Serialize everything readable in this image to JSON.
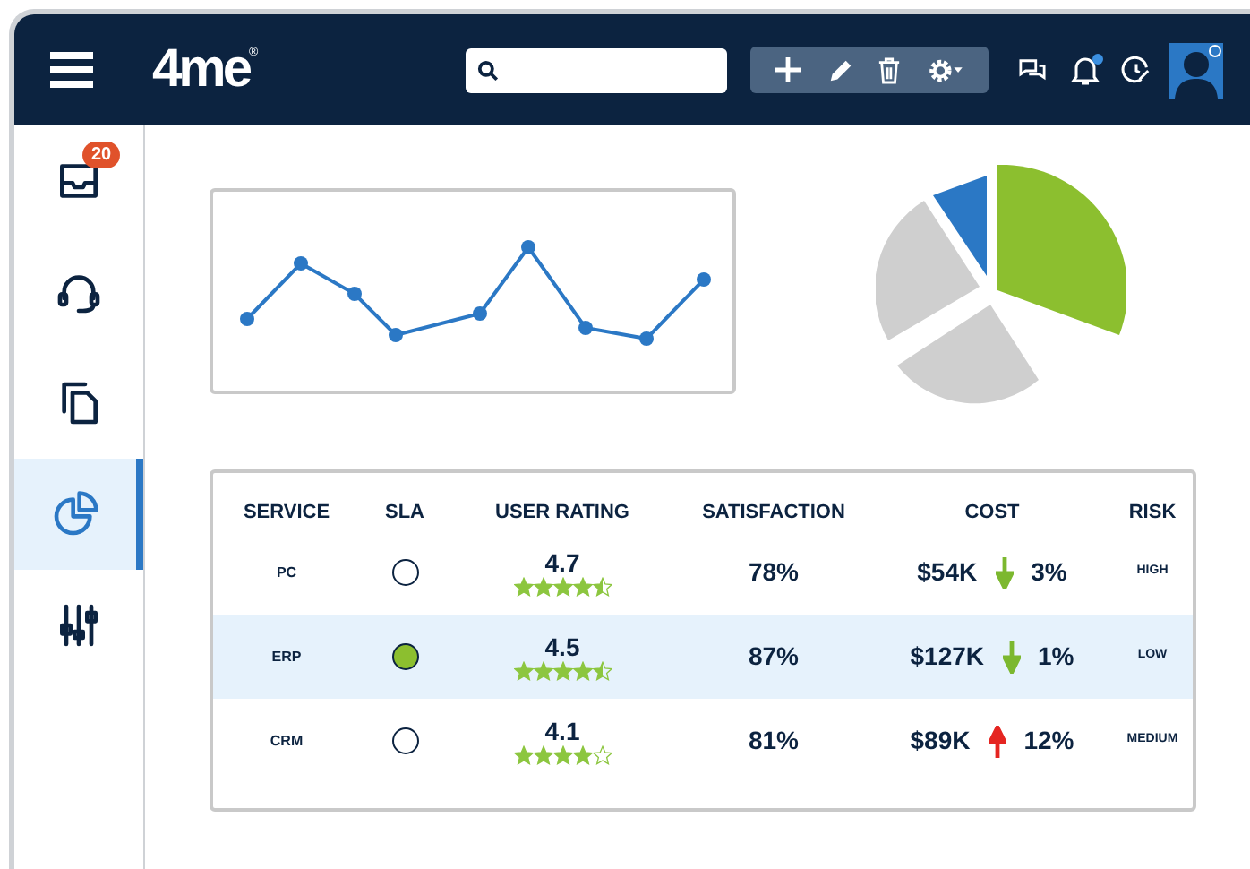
{
  "header": {
    "logo": "4me",
    "logo_mark": "®",
    "notification_dot": true
  },
  "sidebar": {
    "items": [
      {
        "kind": "inbox",
        "selected": false,
        "badge": "20"
      },
      {
        "kind": "headset",
        "selected": false
      },
      {
        "kind": "copy",
        "selected": false
      },
      {
        "kind": "pie",
        "selected": true
      },
      {
        "kind": "sliders",
        "selected": false
      }
    ]
  },
  "table": {
    "columns": [
      "SERVICE",
      "SLA",
      "USER RATING",
      "SATISFACTION",
      "COST",
      "RISK"
    ],
    "rows": [
      {
        "service": "PC",
        "sla_met": false,
        "rating": "4.7",
        "stars": 4.5,
        "satisfaction": "78%",
        "cost": "$54K",
        "cost_up": false,
        "change": "3%",
        "risk": "HIGH",
        "selected": false
      },
      {
        "service": "ERP",
        "sla_met": true,
        "rating": "4.5",
        "stars": 4.5,
        "satisfaction": "87%",
        "cost": "$127K",
        "cost_up": false,
        "change": "1%",
        "risk": "LOW",
        "selected": true
      },
      {
        "service": "CRM",
        "sla_met": false,
        "rating": "4.1",
        "stars": 4,
        "satisfaction": "81%",
        "cost": "$89K",
        "cost_up": true,
        "change": "12%",
        "risk": "MEDIUM",
        "selected": false
      }
    ]
  }
}
